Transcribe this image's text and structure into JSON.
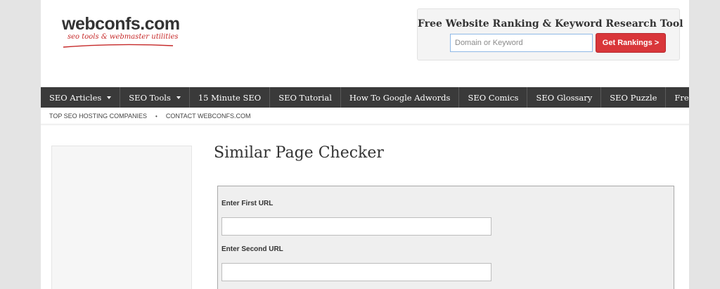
{
  "header": {
    "logo": {
      "name": "webconfs.com",
      "tagline": "seo tools & webmaster utilities"
    },
    "ranking_tool": {
      "title": "Free Website Ranking & Keyword Research Tool",
      "input_placeholder": "Domain or Keyword",
      "button_label": "Get Rankings >"
    }
  },
  "nav": {
    "items": [
      {
        "label": "SEO Articles",
        "dropdown": true
      },
      {
        "label": "SEO Tools",
        "dropdown": true
      },
      {
        "label": "15 Minute SEO",
        "dropdown": false
      },
      {
        "label": "SEO Tutorial",
        "dropdown": false
      },
      {
        "label": "How To Google Adwords",
        "dropdown": false
      },
      {
        "label": "SEO Comics",
        "dropdown": false
      },
      {
        "label": "SEO Glossary",
        "dropdown": false
      },
      {
        "label": "SEO Puzzle",
        "dropdown": false
      },
      {
        "label": "Free Web Tools",
        "dropdown": true
      }
    ]
  },
  "subnav": {
    "links": [
      "TOP SEO HOSTING COMPANIES",
      "CONTACT WEBCONFS.COM"
    ],
    "separator": "•"
  },
  "main": {
    "title": "Similar Page Checker",
    "form": {
      "first_url_label": "Enter First URL",
      "first_url_value": "",
      "second_url_label": "Enter Second URL",
      "second_url_value": ""
    }
  },
  "colors": {
    "nav_bg": "#3a3a3a",
    "accent_red": "#d9363a",
    "page_bg": "#e4e4e4",
    "input_focus_border": "#8fb9e6"
  },
  "icons": {
    "dropdown": "caret-down-icon",
    "subnav_separator": "bullet-icon"
  }
}
